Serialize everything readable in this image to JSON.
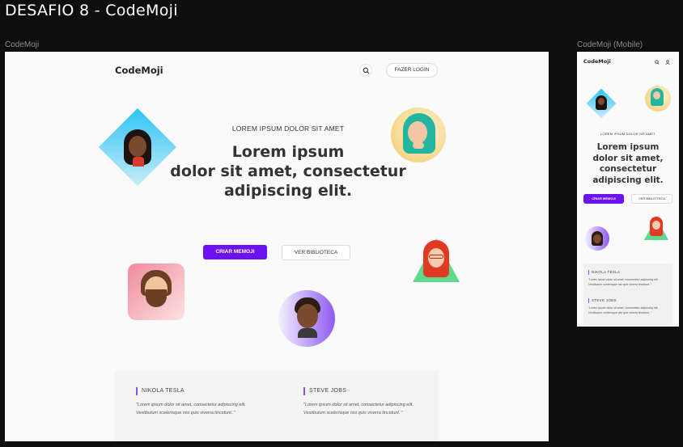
{
  "page_title": "DESAFIO 8 - CodeMoji",
  "desktop": {
    "frame_label": "CodeMoji",
    "header": {
      "logo": "CodeMoji",
      "login_label": "FAZER LOGIN"
    },
    "hero": {
      "eyebrow": "LOREM IPSUM DOLOR SIT AMET",
      "line1": "Lorem ipsum",
      "line2": "dolor sit amet, consectetur",
      "line3": "adipiscing elit."
    },
    "buttons": {
      "primary": "CRIAR MEMOJI",
      "secondary": "VER BIBLIOTECA"
    },
    "testimonials": [
      {
        "name": "NIKOLA TESLA",
        "text": "\"Lorem ipsum dolor sit amet, consectetur adipiscing elit. Vestibulum scelerisque nisi quis viverra tincidunt. \""
      },
      {
        "name": "STEVE JOBS",
        "text": "\"Lorem ipsum dolor sit amet, consectetur adipiscing elit. Vestibulum scelerisque nisi quis viverra tincidunt. \""
      }
    ]
  },
  "mobile": {
    "frame_label": "CodeMoji (Mobile)",
    "header": {
      "logo": "CodeMoji"
    },
    "hero": {
      "eyebrow": "LOREM IPSUM DOLOR SIT AMET",
      "line1": "Lorem ipsum",
      "line2": "dolor sit amet,",
      "line3": "consectetur",
      "line4": "adipiscing elit."
    },
    "buttons": {
      "primary": "CRIAR MEMOJI",
      "secondary": "VER BIBLIOTECA"
    },
    "testimonials": [
      {
        "name": "NIKOLA TESLA",
        "text": "\"Lorem ipsum dolor sit amet, consectetur adipiscing elit. Vestibulum scelerisque nisi quis viverra tincidunt. \""
      },
      {
        "name": "STEVE JOBS",
        "text": "\"Lorem ipsum dolor sit amet, consectetur adipiscing elit. Vestibulum scelerisque nisi quis viverra tincidunt. \""
      }
    ]
  },
  "colors": {
    "canvas": "#0e0e0e",
    "frame_bg": "#fafafa",
    "accent": "#6c11f0",
    "quote_bar": "#8e4dff"
  },
  "icons": [
    "search-icon",
    "user-icon"
  ]
}
